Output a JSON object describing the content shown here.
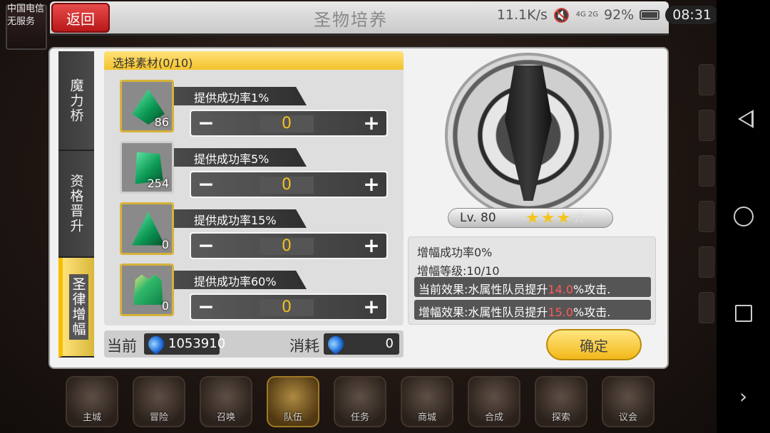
{
  "status_bar": {
    "carrier_line1": "中国电信",
    "carrier_line2": "无服务",
    "net_speed": "11.1K/s",
    "network": "4G 2G",
    "battery": "92%",
    "time": "08:31"
  },
  "header": {
    "back_label": "返回",
    "title": "圣物培养"
  },
  "side_tabs": [
    {
      "label": "魔力桥",
      "active": false
    },
    {
      "label": "资格晋升",
      "active": false
    },
    {
      "label": "圣律增幅",
      "active": true
    }
  ],
  "materials": {
    "header": "选择素材(0/10)",
    "items": [
      {
        "icon": "green-crystal-shard-icon",
        "count": "86",
        "rate_label": "提供成功率1%",
        "value": "0"
      },
      {
        "icon": "green-crystal-cube-icon",
        "count": "254",
        "rate_label": "提供成功率5%",
        "value": "0"
      },
      {
        "icon": "green-crystal-pyramid-icon",
        "count": "0",
        "rate_label": "提供成功率15%",
        "value": "0"
      },
      {
        "icon": "green-crystal-crown-icon",
        "count": "0",
        "rate_label": "提供成功率60%",
        "value": "0"
      }
    ],
    "minus_symbol": "−",
    "plus_symbol": "+"
  },
  "currency": {
    "current_label": "当前",
    "current_value": "1053910",
    "cost_label": "消耗",
    "cost_value": "0",
    "icon": "blue-gem-icon"
  },
  "relic": {
    "icon": "dark-sword-emblem-icon",
    "level": "Lv. 80",
    "stars_total": 4,
    "stars_filled": 3,
    "star_on": "★",
    "star_off": "☆"
  },
  "info": {
    "success_rate": "增幅成功率0%",
    "amp_level": "增幅等级:10/10",
    "current_effect_prefix": "当前效果:水属性队员提升",
    "current_effect_value": "14.0",
    "current_effect_suffix": "%攻击.",
    "amp_effect_prefix": "增幅效果:水属性队员提升",
    "amp_effect_value": "15.0",
    "amp_effect_suffix": "%攻击.",
    "highlight_color": "#ff5a5a"
  },
  "confirm_label": "确定",
  "bottom_nav": [
    {
      "label": "主城",
      "icon": "castle-icon",
      "active": false
    },
    {
      "label": "冒险",
      "icon": "crossed-swords-icon",
      "active": false
    },
    {
      "label": "召唤",
      "icon": "summon-cards-icon",
      "active": false
    },
    {
      "label": "队伍",
      "icon": "winged-shield-icon",
      "active": true
    },
    {
      "label": "任务",
      "icon": "quest-book-icon",
      "active": false
    },
    {
      "label": "商城",
      "icon": "shop-icon",
      "active": false
    },
    {
      "label": "合成",
      "icon": "synthesis-orb-icon",
      "active": false
    },
    {
      "label": "探索",
      "icon": "explore-compass-icon",
      "active": false
    },
    {
      "label": "议会",
      "icon": "council-icon",
      "active": false
    }
  ],
  "colors": {
    "accent_gold": "#f3c22a",
    "back_red": "#d12a2a",
    "value_gold": "#f3c022"
  }
}
